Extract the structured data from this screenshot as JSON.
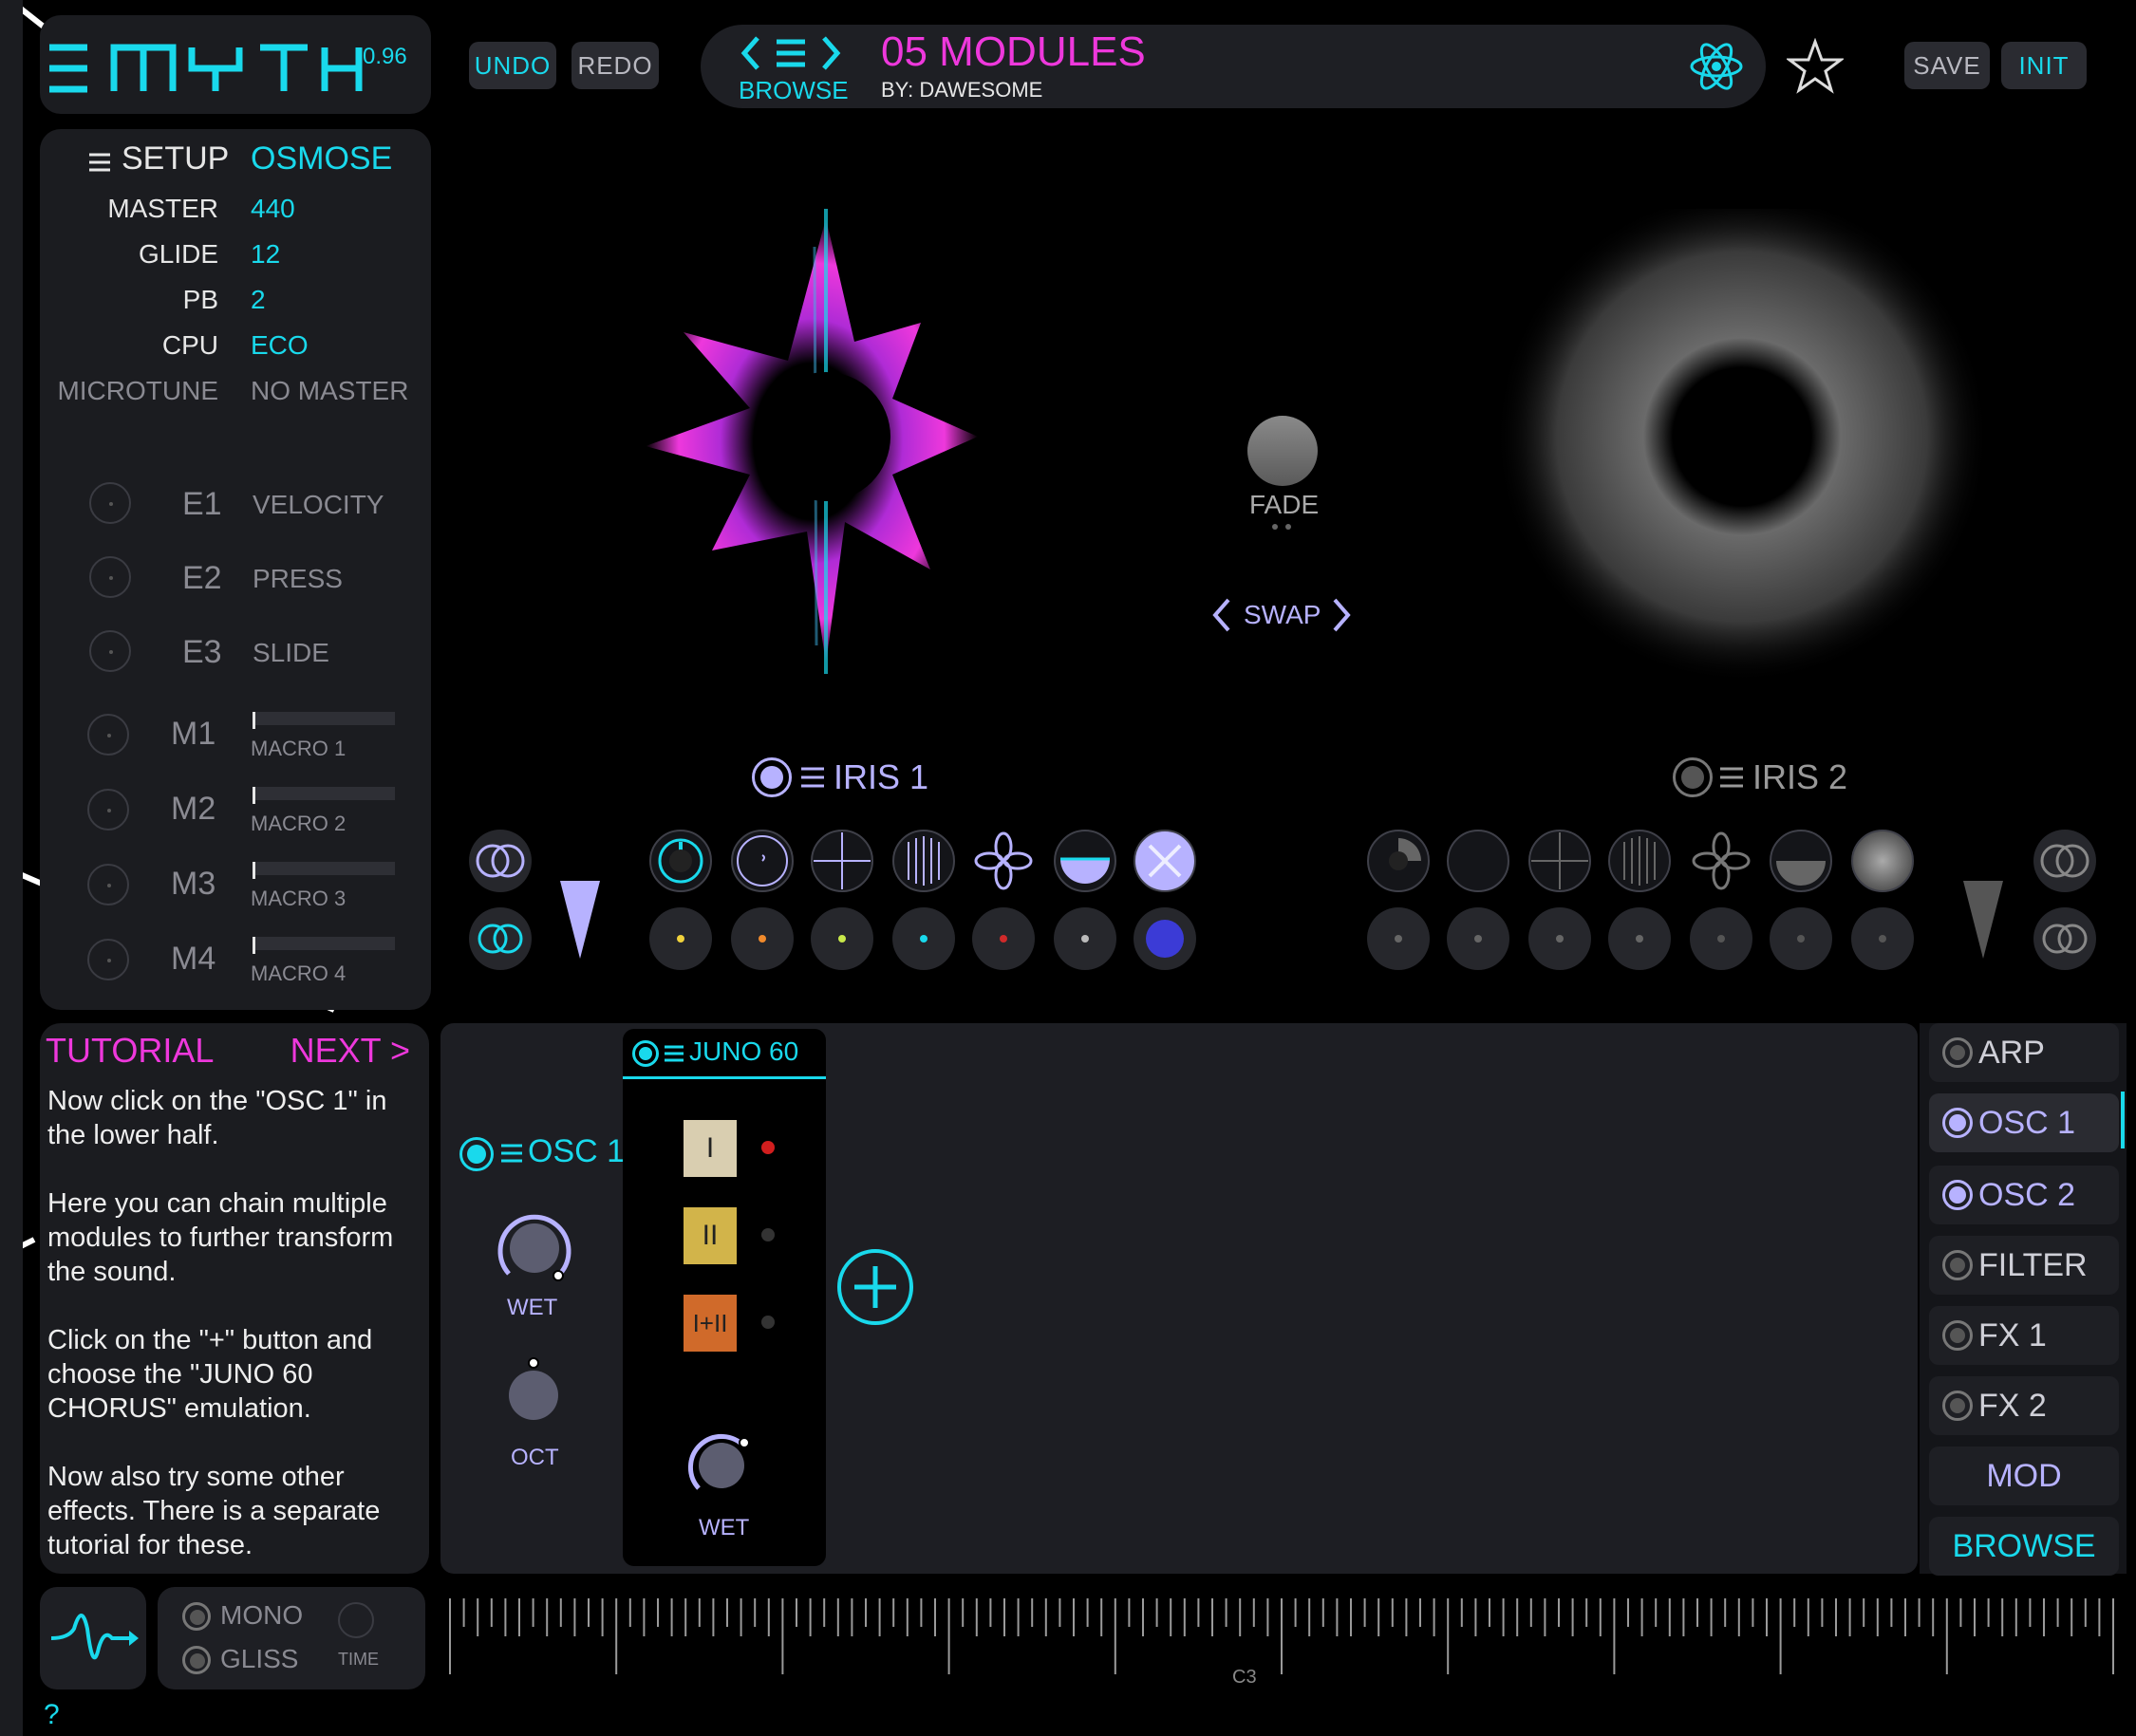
{
  "header": {
    "logo": "MYTH",
    "version": "0.96",
    "undo_label": "UNDO",
    "redo_label": "REDO",
    "browse_label": "BROWSE",
    "preset_name": "05 MODULES",
    "preset_author": "BY: DAWESOME",
    "save_label": "SAVE",
    "init_label": "INIT"
  },
  "setup": {
    "title": "SETUP",
    "title_value": "OSMOSE",
    "rows": [
      {
        "label": "MASTER",
        "value": "440"
      },
      {
        "label": "GLIDE",
        "value": "12"
      },
      {
        "label": "PB",
        "value": "2"
      },
      {
        "label": "CPU",
        "value": "ECO"
      },
      {
        "label": "MICROTUNE",
        "value": "NO MASTER"
      }
    ],
    "expressions": [
      {
        "id": "E1",
        "name": "VELOCITY"
      },
      {
        "id": "E2",
        "name": "PRESS"
      },
      {
        "id": "E3",
        "name": "SLIDE"
      }
    ],
    "macros": [
      {
        "id": "M1",
        "name": "MACRO 1"
      },
      {
        "id": "M2",
        "name": "MACRO 2"
      },
      {
        "id": "M3",
        "name": "MACRO 3"
      },
      {
        "id": "M4",
        "name": "MACRO 4"
      }
    ]
  },
  "center": {
    "fade_label": "FADE",
    "swap_label": "SWAP",
    "iris1_label": "IRIS 1",
    "iris2_label": "IRIS 2"
  },
  "tutorial": {
    "title": "TUTORIAL",
    "next_label": "NEXT >",
    "paragraphs": [
      "Now click on the \"OSC 1\" in the lower half.",
      "Here you can chain multiple modules to further transform the sound.",
      "Click on the \"+\" button and choose the \"JUNO 60 CHORUS\" emulation.",
      "Now also try some other effects. There is a separate tutorial for these."
    ]
  },
  "osc": {
    "title": "OSC 1",
    "wet_label": "WET",
    "oct_label": "OCT"
  },
  "juno": {
    "title": "JUNO 60",
    "btn1": "I",
    "btn2": "II",
    "btn3": "I+II",
    "wet_label": "WET"
  },
  "sidebar": {
    "items": [
      {
        "label": "ARP"
      },
      {
        "label": "OSC 1"
      },
      {
        "label": "OSC 2"
      },
      {
        "label": "FILTER"
      },
      {
        "label": "FX 1"
      },
      {
        "label": "FX 2"
      }
    ],
    "mod_label": "MOD",
    "browse_label": "BROWSE"
  },
  "bottom": {
    "mono_label": "MONO",
    "gliss_label": "GLISS",
    "time_label": "TIME",
    "keyboard_label": "C3",
    "help_label": "?"
  },
  "colors": {
    "accent_cyan": "#19d9ec",
    "accent_magenta": "#ee38dc",
    "accent_lavender": "#b7b2ff",
    "panel": "#1b1c20"
  }
}
